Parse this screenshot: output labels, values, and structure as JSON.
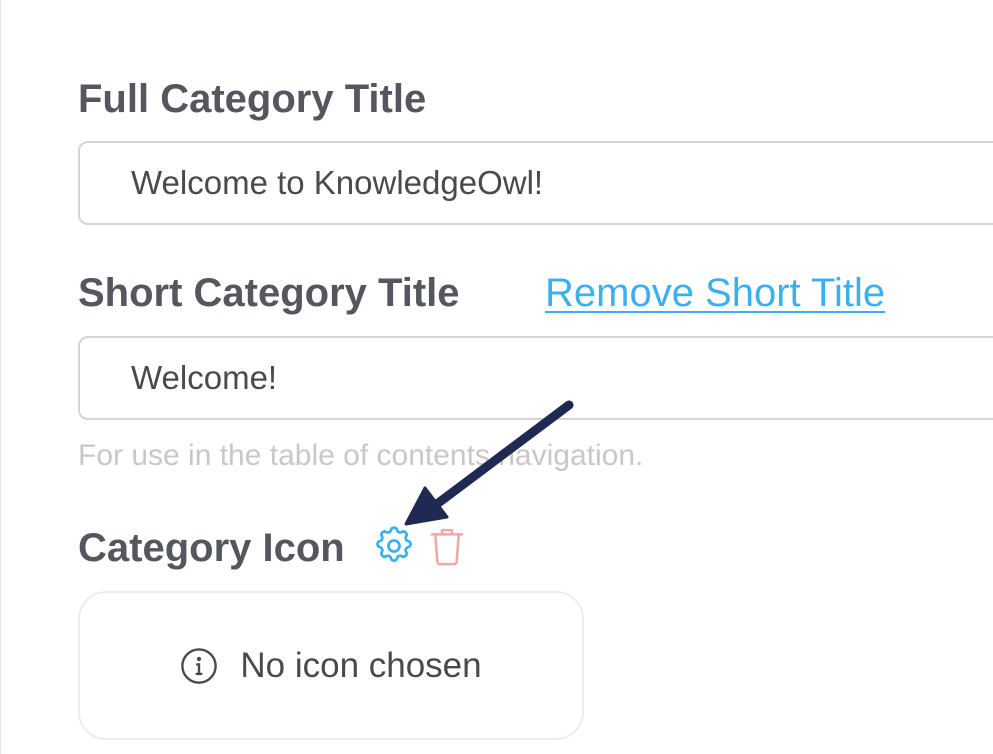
{
  "full_title": {
    "label": "Full Category Title",
    "value": "Welcome to KnowledgeOwl!"
  },
  "short_title": {
    "label": "Short Category Title",
    "remove_link": "Remove Short Title",
    "value": "Welcome!",
    "help": "For use in the table of contents navigation."
  },
  "category_icon": {
    "label": "Category Icon",
    "settings_icon": "gear-icon",
    "delete_icon": "trash-icon",
    "empty_text": "No icon chosen",
    "empty_icon": "info-circle-icon"
  },
  "colors": {
    "label": "#54575e",
    "link": "#3bb0ee",
    "gear": "#3bb0ee",
    "trash": "#f3a6a6",
    "arrow": "#1f2a52"
  }
}
